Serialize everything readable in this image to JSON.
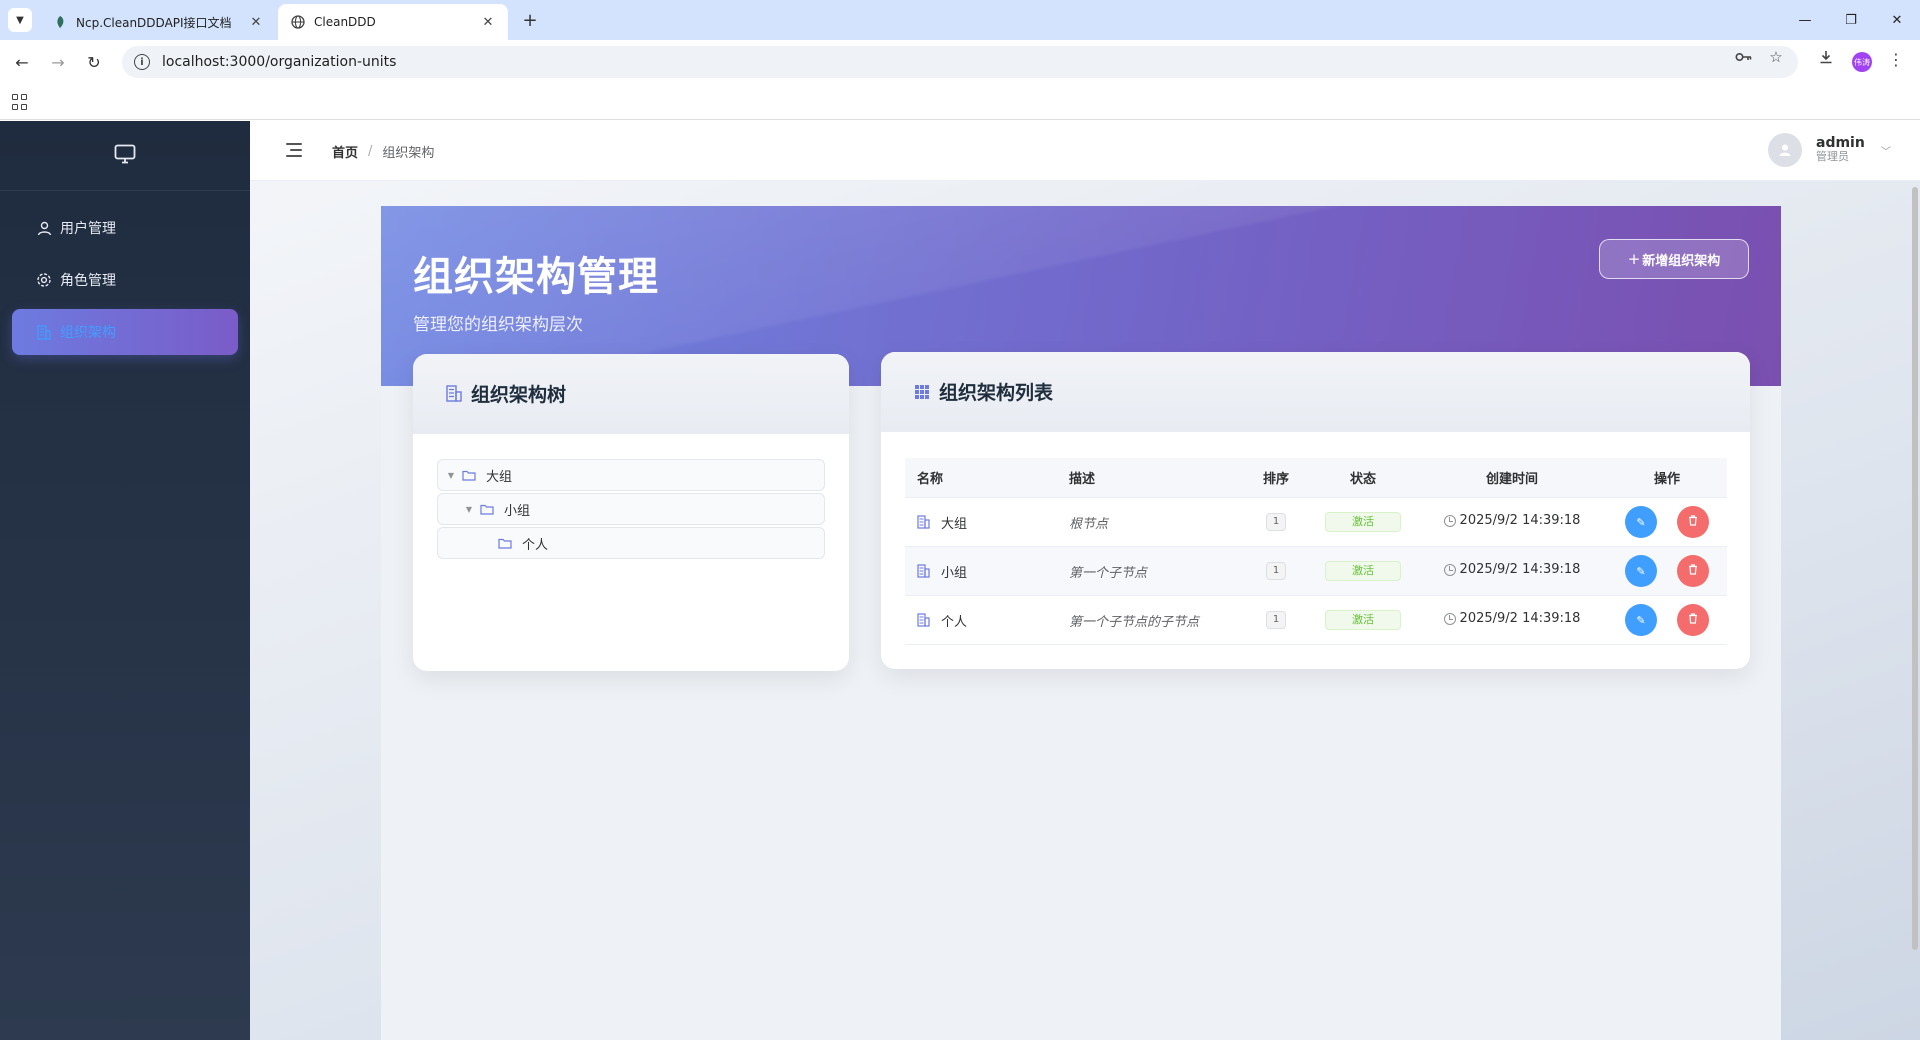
{
  "browser": {
    "tabs": [
      {
        "title": "Ncp.CleanDDDAPI接口文档",
        "active": false
      },
      {
        "title": "CleanDDD",
        "active": true
      }
    ],
    "url": "localhost:3000/organization-units",
    "profile_initials": "伟涛"
  },
  "sidebar": {
    "items": [
      {
        "label": "用户管理",
        "icon": "user-icon",
        "active": false
      },
      {
        "label": "角色管理",
        "icon": "gear-icon",
        "active": false
      },
      {
        "label": "组织架构",
        "icon": "building-icon",
        "active": true
      }
    ]
  },
  "header": {
    "breadcrumb": {
      "home": "首页",
      "separator": "/",
      "current": "组织架构"
    },
    "user": {
      "name": "admin",
      "role": "管理员"
    }
  },
  "page": {
    "title": "组织架构管理",
    "subtitle": "管理您的组织架构层次",
    "add_button": "新增组织架构"
  },
  "tree_card": {
    "title": "组织架构树",
    "nodes": [
      {
        "label": "大组",
        "level": 0,
        "expandable": true
      },
      {
        "label": "小组",
        "level": 1,
        "expandable": true
      },
      {
        "label": "个人",
        "level": 2,
        "expandable": false
      }
    ]
  },
  "list_card": {
    "title": "组织架构列表",
    "columns": [
      "名称",
      "描述",
      "排序",
      "状态",
      "创建时间",
      "操作"
    ],
    "rows": [
      {
        "name": "大组",
        "description": "根节点",
        "sort": "1",
        "status": "激活",
        "created": "2025/9/2 14:39:18"
      },
      {
        "name": "小组",
        "description": "第一个子节点",
        "sort": "1",
        "status": "激活",
        "created": "2025/9/2 14:39:18"
      },
      {
        "name": "个人",
        "description": "第一个子节点的子节点",
        "sort": "1",
        "status": "激活",
        "created": "2025/9/2 14:39:18"
      }
    ]
  },
  "colors": {
    "primary": "#409eff",
    "danger": "#f56c6c",
    "success": "#67c23a",
    "banner_start": "#6f86e2",
    "banner_end": "#7a4fb0",
    "sidebar_bg": "#1f2b3e"
  }
}
